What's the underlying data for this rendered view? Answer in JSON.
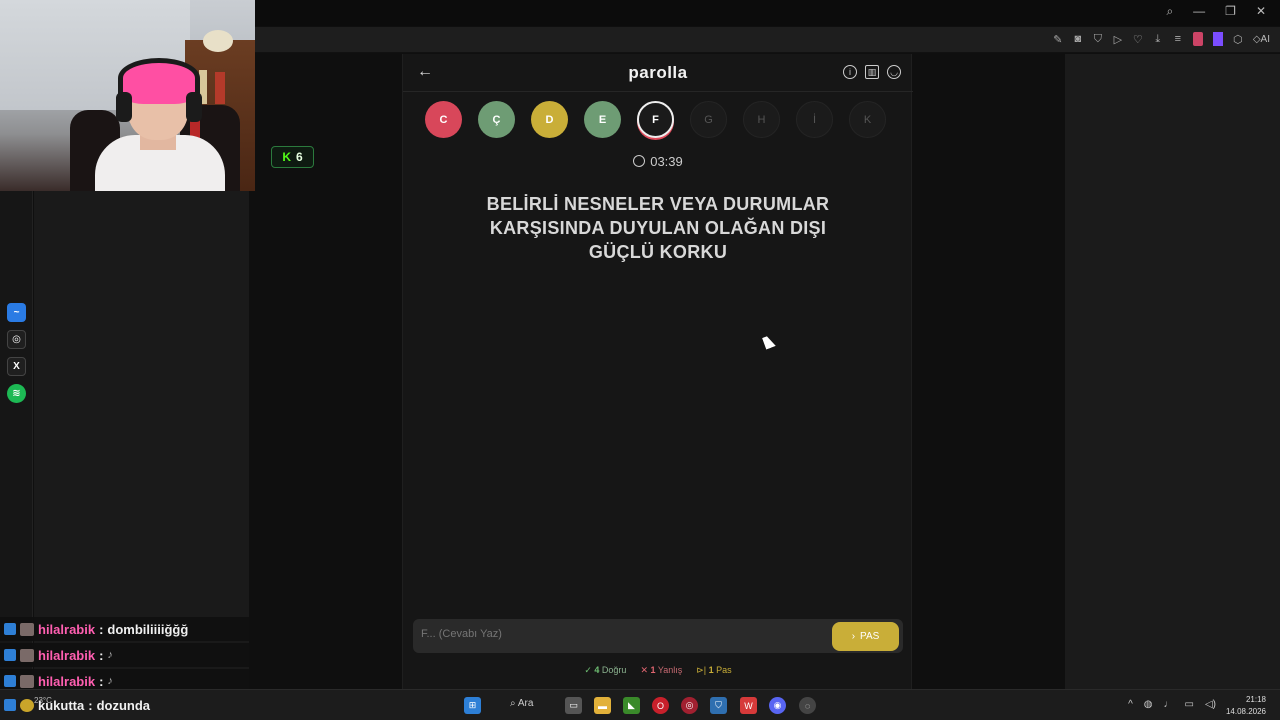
{
  "game": {
    "title": "parolla",
    "timer": "03:39",
    "question": "BELİRLİ NESNELER VEYA DURUMLAR KARŞISINDA DUYULAN OLAĞAN DIŞI GÜÇLÜ KORKU",
    "answer_placeholder": "F... (Cevabı Yaz)",
    "pas_label": "PAS",
    "letters": [
      {
        "letter": "C",
        "state": "wrong",
        "color": "#d8475a"
      },
      {
        "letter": "Ç",
        "state": "correct",
        "color": "#6e9c74"
      },
      {
        "letter": "D",
        "state": "pass",
        "color": "#c9ae38"
      },
      {
        "letter": "E",
        "state": "correct",
        "color": "#6e9c74"
      },
      {
        "letter": "F",
        "state": "current",
        "color": "#1a1a1a"
      },
      {
        "letter": "G",
        "state": "pending",
        "color": "#1b1b1b"
      },
      {
        "letter": "H",
        "state": "pending",
        "color": "#1b1b1b"
      },
      {
        "letter": "İ",
        "state": "pending",
        "color": "#1b1b1b"
      },
      {
        "letter": "K",
        "state": "pending",
        "color": "#1b1b1b"
      }
    ],
    "stats": {
      "correct_count": "4",
      "correct_label": "Doğru",
      "wrong_count": "1",
      "wrong_label": "Yanlış",
      "pass_count": "1",
      "pass_label": "Pas"
    }
  },
  "kick": {
    "count": "6",
    "color": "#53fc18"
  },
  "chat": [
    {
      "user": "hilalrabik",
      "message": "dombiliiiiğğğ"
    },
    {
      "user": "hilalrabik",
      "message": ""
    },
    {
      "user": "hilalrabik",
      "message": ""
    },
    {
      "user": "kukutta",
      "message": "dozunda"
    }
  ],
  "taskbar": {
    "search_label": "Ara",
    "weather": "23°C",
    "time": "21:18",
    "date": "14.08.2026"
  }
}
